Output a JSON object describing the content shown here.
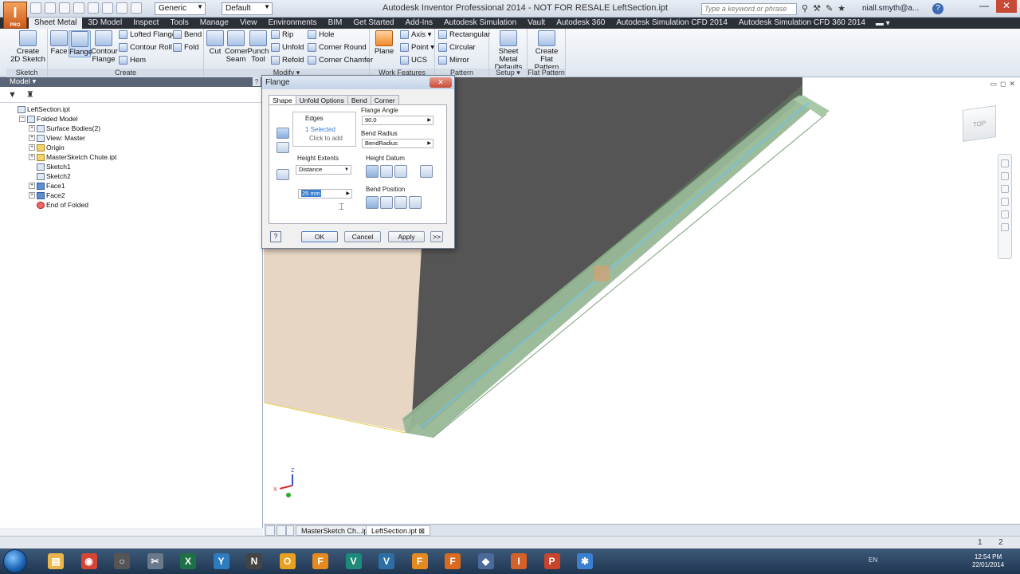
{
  "titlebar": {
    "app_logo": "I",
    "app_logo_sub": "PRO",
    "style_combo": "Generic",
    "default_combo": "Default",
    "title": "Autodesk Inventor Professional 2014 - NOT FOR RESALE    LeftSection.ipt",
    "search_placeholder": "Type a keyword or phrase",
    "user": "niall.smyth@a...",
    "help": "?",
    "minimize": "—",
    "close": "✕"
  },
  "ribbon_tabs": [
    "Sheet Metal",
    "3D Model",
    "Inspect",
    "Tools",
    "Manage",
    "View",
    "Environments",
    "BIM",
    "Get Started",
    "Add-Ins",
    "Autodesk Simulation",
    "Vault",
    "Autodesk 360",
    "Autodesk Simulation CFD 2014",
    "Autodesk Simulation CFD 360 2014"
  ],
  "ribbon": {
    "sketch": {
      "label": "Sketch",
      "create_2d_sketch": "Create\n2D Sketch"
    },
    "create": {
      "label": "Create",
      "face": "Face",
      "flange": "Flange",
      "contour_flange": "Contour\nFlange",
      "lofted_flange": "Lofted Flange",
      "contour_roll": "Contour Roll",
      "hem": "Hem",
      "bend": "Bend",
      "fold": "Fold"
    },
    "modify": {
      "label": "Modify ▾",
      "cut": "Cut",
      "corner_seam": "Corner\nSeam",
      "punch_tool": "Punch\nTool",
      "rip": "Rip",
      "unfold": "Unfold",
      "refold": "Refold",
      "hole": "Hole",
      "corner_round": "Corner Round",
      "corner_chamfer": "Corner Chamfer"
    },
    "work_features": {
      "label": "Work Features",
      "plane": "Plane",
      "axis": "Axis ▾",
      "point": "Point ▾",
      "ucs": "UCS"
    },
    "pattern": {
      "label": "Pattern",
      "rectangular": "Rectangular",
      "circular": "Circular",
      "mirror": "Mirror"
    },
    "setup": {
      "label": "Setup ▾",
      "defaults": "Sheet Metal\nDefaults"
    },
    "flat_pattern": {
      "label": "Flat Pattern",
      "create": "Create\nFlat Pattern"
    }
  },
  "browser": {
    "title": "Model ▾",
    "help": "?",
    "tree": [
      {
        "label": "LeftSection.ipt",
        "indent": 0,
        "icon": "part-icon",
        "exp": ""
      },
      {
        "label": "Folded Model",
        "indent": 1,
        "icon": "folder-icon",
        "exp": "−"
      },
      {
        "label": "Surface Bodies(2)",
        "indent": 2,
        "icon": "folder-icon",
        "exp": "+"
      },
      {
        "label": "View: Master",
        "indent": 2,
        "icon": "folder-icon",
        "exp": "+"
      },
      {
        "label": "Origin",
        "indent": 2,
        "icon": "folder-yellow-icon",
        "exp": "+"
      },
      {
        "label": "MasterSketch Chute.ipt",
        "indent": 2,
        "icon": "folder-yellow-icon",
        "exp": "+"
      },
      {
        "label": "Sketch1",
        "indent": 2,
        "icon": "sketch-icon",
        "exp": ""
      },
      {
        "label": "Sketch2",
        "indent": 2,
        "icon": "sketch-icon",
        "exp": ""
      },
      {
        "label": "Face1",
        "indent": 2,
        "icon": "face-icon",
        "exp": "+"
      },
      {
        "label": "Face2",
        "indent": 2,
        "icon": "face-icon",
        "exp": "+"
      },
      {
        "label": "End of Folded",
        "indent": 2,
        "icon": "end-of-part-icon",
        "exp": ""
      }
    ]
  },
  "dialog": {
    "title": "Flange",
    "close": "✕",
    "tabs": [
      "Shape",
      "Unfold Options",
      "Bend",
      "Corner"
    ],
    "edges_label": "Edges",
    "edges_selected": "1 Selected",
    "edges_click": "Click to add",
    "flange_angle_label": "Flange Angle",
    "flange_angle_value": "90.0",
    "bend_radius_label": "Bend Radius",
    "bend_radius_value": "BendRadius",
    "height_extents_label": "Height Extents",
    "height_extents_value": "Distance",
    "height_value": "25 mm",
    "height_datum_label": "Height Datum",
    "bend_position_label": "Bend Position",
    "help": "?",
    "ok": "OK",
    "cancel": "Cancel",
    "apply": "Apply",
    "more": ">>"
  },
  "viewport": {
    "viewcube_label": "TOP",
    "axis_z": "Z",
    "axis_x": "X"
  },
  "doc_tabs": [
    "MasterSketch Ch...ipt",
    "LeftSection.ipt ⊠"
  ],
  "status": {
    "left_num": "1",
    "right_num": "2"
  },
  "taskbar": {
    "lang": "EN",
    "time": "12:54 PM",
    "date": "22/01/2014",
    "apps": [
      {
        "name": "explorer",
        "glyph": "▤",
        "color": "#e8b64a"
      },
      {
        "name": "chrome",
        "glyph": "◉",
        "color": "#d64534"
      },
      {
        "name": "circle",
        "glyph": "○",
        "color": "#555"
      },
      {
        "name": "tool",
        "glyph": "✂",
        "color": "#6a7a8a"
      },
      {
        "name": "excel",
        "glyph": "X",
        "color": "#1e7145"
      },
      {
        "name": "yammer",
        "glyph": "Y",
        "color": "#2f7bbf"
      },
      {
        "name": "app-n",
        "glyph": "N",
        "color": "#444"
      },
      {
        "name": "outlook",
        "glyph": "O",
        "color": "#e7a020"
      },
      {
        "name": "app-fusion",
        "glyph": "F",
        "color": "#e48a1f"
      },
      {
        "name": "app-v1",
        "glyph": "V",
        "color": "#1d8a7a"
      },
      {
        "name": "app-v2",
        "glyph": "V",
        "color": "#2b6fa6"
      },
      {
        "name": "app-f2",
        "glyph": "F",
        "color": "#e48a1f"
      },
      {
        "name": "app-f3",
        "glyph": "F",
        "color": "#d96a20"
      },
      {
        "name": "app-cube",
        "glyph": "◆",
        "color": "#4a6a9a"
      },
      {
        "name": "app-i",
        "glyph": "I",
        "color": "#d6602a"
      },
      {
        "name": "powerpoint",
        "glyph": "P",
        "color": "#c8442a"
      },
      {
        "name": "app-flower",
        "glyph": "✱",
        "color": "#3a7fd0"
      }
    ]
  }
}
